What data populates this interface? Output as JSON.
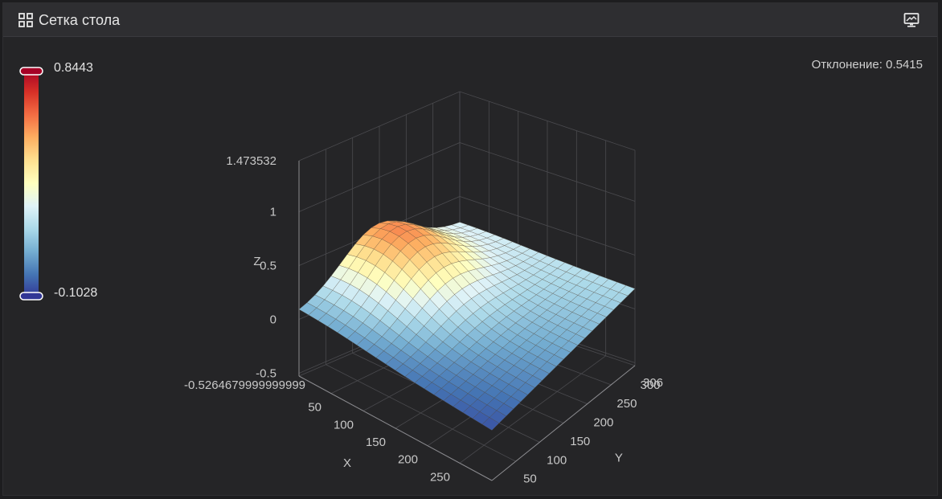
{
  "header": {
    "title": "Сетка стола",
    "grid_icon": "grid-icon",
    "display_icon": "display-icon"
  },
  "deviation_text": "Отклонение: 0.5415",
  "colorbar": {
    "max_label": "0.8443",
    "min_label": "-0.1028",
    "colors": [
      "#a50026",
      "#d73027",
      "#f46d43",
      "#fdae61",
      "#fee090",
      "#ffffbf",
      "#e0f3f8",
      "#abd9e9",
      "#74add1",
      "#4575b4",
      "#313695"
    ]
  },
  "chart_data": {
    "type": "surface",
    "z_ticks": [
      "1.473532",
      "1",
      "0.5",
      "0",
      "-0.5"
    ],
    "z_min_label": "-0.5264679999999999",
    "z_label": "Z",
    "x_ticks": [
      "50",
      "100",
      "150",
      "200",
      "250"
    ],
    "x_label": "X",
    "y_ticks": [
      "50",
      "100",
      "150",
      "200",
      "250",
      "300",
      "306"
    ],
    "y_label": "Y",
    "x_range": [
      0,
      300
    ],
    "y_range": [
      0,
      306
    ],
    "z_range": [
      -0.526468,
      1.473532
    ],
    "value_range": [
      -0.1028,
      0.8443
    ]
  }
}
